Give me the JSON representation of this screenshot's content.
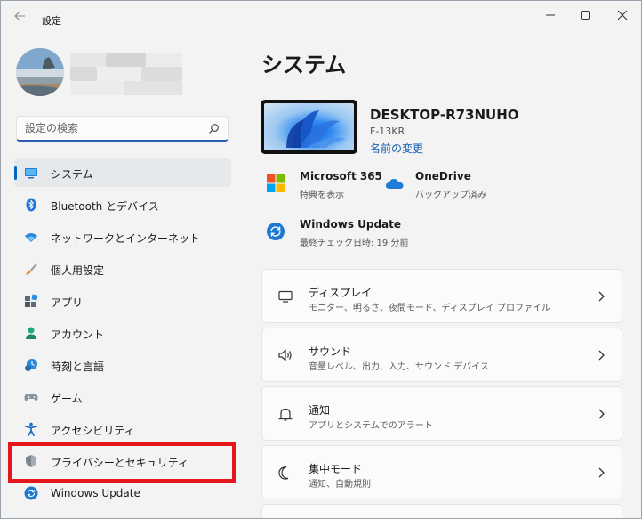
{
  "app": {
    "title": "設定"
  },
  "search": {
    "placeholder": "設定の検索"
  },
  "nav": {
    "items": [
      {
        "label": "システム",
        "icon": "monitor-icon",
        "selected": true
      },
      {
        "label": "Bluetooth とデバイス",
        "icon": "bluetooth-icon",
        "selected": false
      },
      {
        "label": "ネットワークとインターネット",
        "icon": "wifi-icon",
        "selected": false
      },
      {
        "label": "個人用設定",
        "icon": "brush-icon",
        "selected": false
      },
      {
        "label": "アプリ",
        "icon": "apps-icon",
        "selected": false
      },
      {
        "label": "アカウント",
        "icon": "person-icon",
        "selected": false
      },
      {
        "label": "時刻と言語",
        "icon": "clock-globe-icon",
        "selected": false
      },
      {
        "label": "ゲーム",
        "icon": "gamepad-icon",
        "selected": false
      },
      {
        "label": "アクセシビリティ",
        "icon": "accessibility-icon",
        "selected": false
      },
      {
        "label": "プライバシーとセキュリティ",
        "icon": "shield-icon",
        "selected": false
      },
      {
        "label": "Windows Update",
        "icon": "update-icon",
        "selected": false
      }
    ]
  },
  "main": {
    "title": "システム",
    "device": {
      "name": "DESKTOP-R73NUHO",
      "model": "F-13KR",
      "rename_link": "名前の変更"
    },
    "quick": {
      "ms365": {
        "title": "Microsoft 365",
        "subtitle": "特典を表示"
      },
      "onedrive": {
        "title": "OneDrive",
        "subtitle": "バックアップ済み"
      },
      "windows_update": {
        "title": "Windows Update",
        "subtitle": "最終チェック日時: 19 分前"
      }
    },
    "cards": [
      {
        "title": "ディスプレイ",
        "subtitle": "モニター、明るさ、夜間モード、ディスプレイ プロファイル",
        "icon": "display-icon"
      },
      {
        "title": "サウンド",
        "subtitle": "音量レベル、出力、入力、サウンド デバイス",
        "icon": "speaker-icon"
      },
      {
        "title": "通知",
        "subtitle": "アプリとシステムでのアラート",
        "icon": "bell-icon"
      },
      {
        "title": "集中モード",
        "subtitle": "通知、自動規則",
        "icon": "moon-icon"
      }
    ]
  },
  "colors": {
    "accent": "#0067c0",
    "highlight": "#e5161b",
    "link": "#1a5fb4",
    "background": "#f3f3f3"
  }
}
